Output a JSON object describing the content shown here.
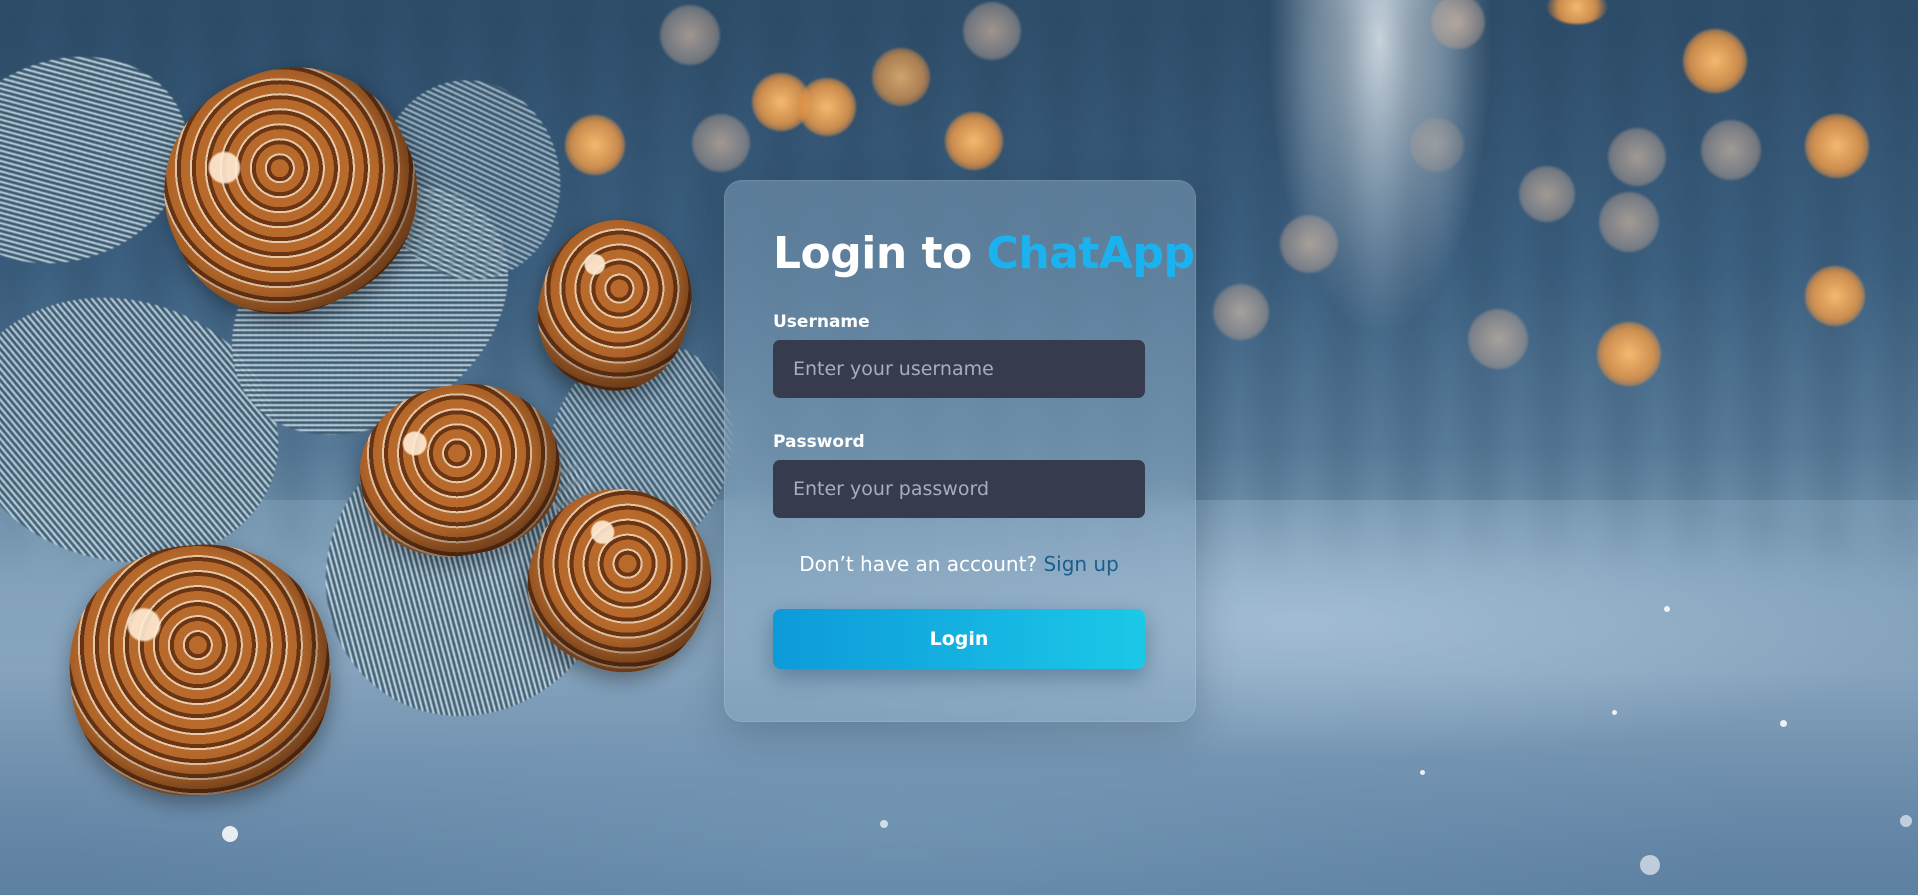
{
  "login": {
    "title_prefix": "Login to ",
    "title_brand": "ChatApp",
    "username_label": "Username",
    "username_placeholder": "Enter your username",
    "password_label": "Password",
    "password_placeholder": "Enter your password",
    "signup_prompt": "Don’t have an account? ",
    "signup_link": "Sign up",
    "login_button": "Login"
  },
  "colors": {
    "brand_accent": "#1ab3f0",
    "input_bg": "#363c4e",
    "button_gradient_start": "#0d9ad9",
    "button_gradient_end": "#1cc8e8",
    "link": "#1a5e8e"
  }
}
